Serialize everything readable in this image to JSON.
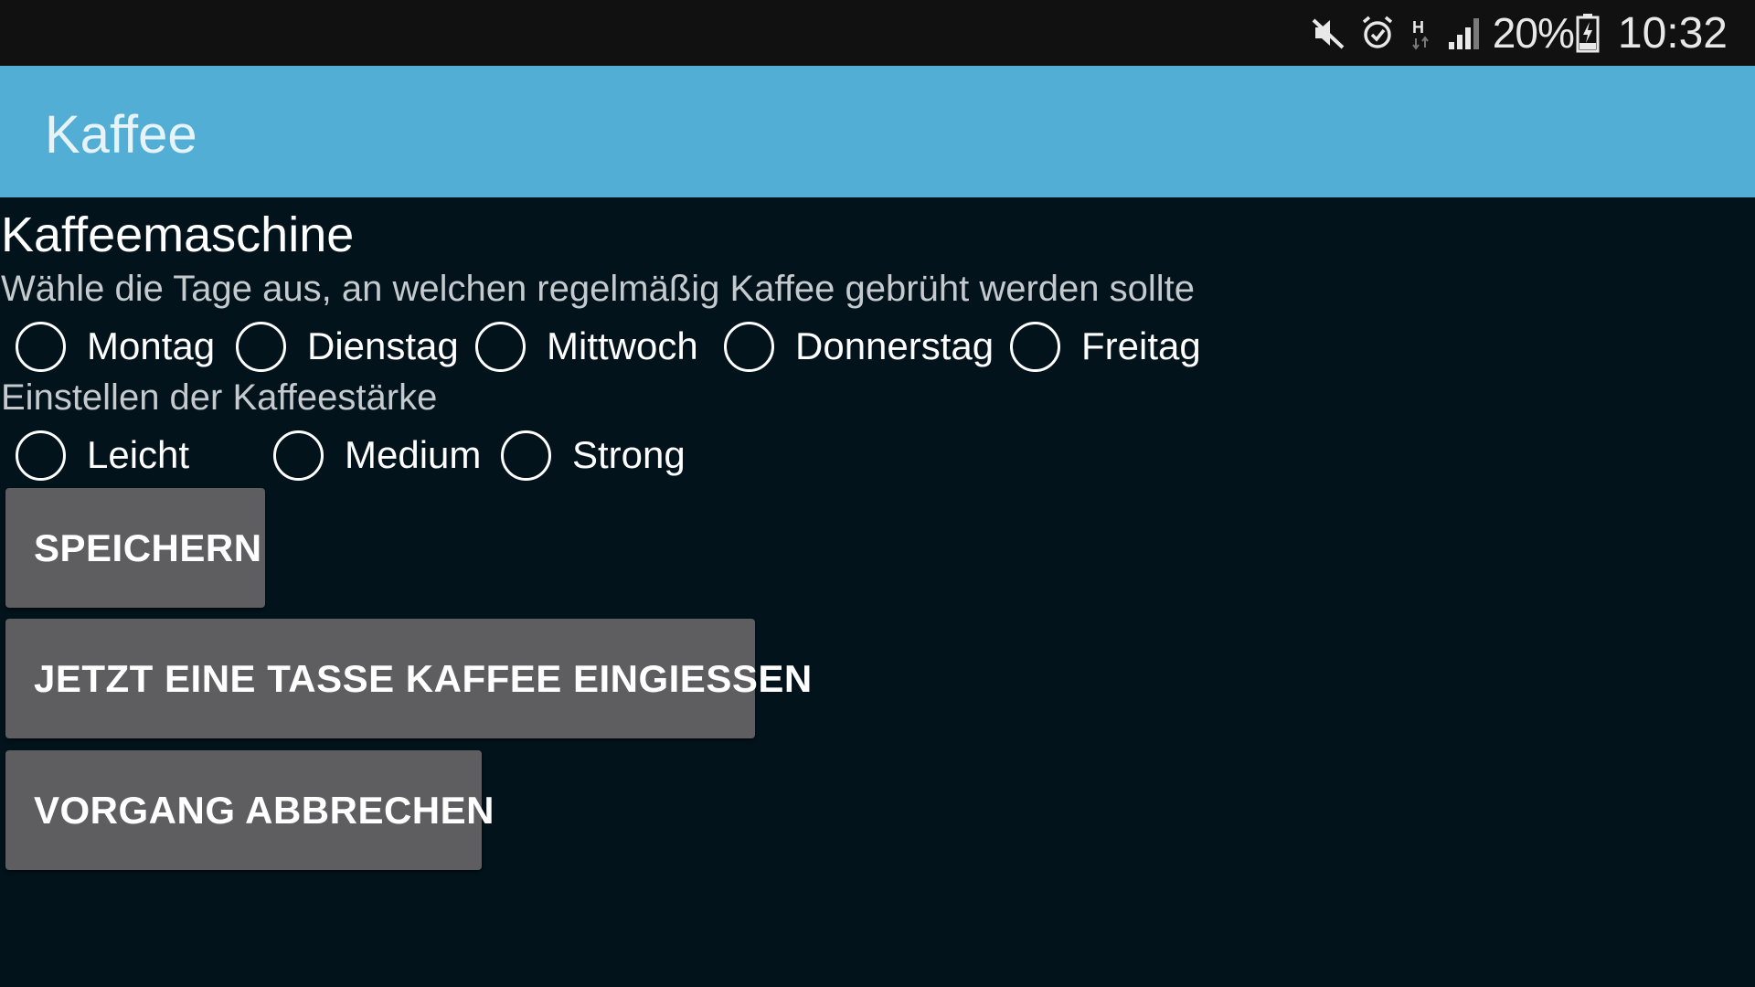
{
  "statusbar": {
    "icons": [
      "mute-icon",
      "alarm-icon",
      "network-h-icon",
      "signal-icon"
    ],
    "battery_text": "20%",
    "time": "10:32"
  },
  "appbar": {
    "title": "Kaffee"
  },
  "main": {
    "heading": "Kaffeemaschine",
    "days_prompt": "Wähle die Tage aus, an welchen regelmäßig Kaffee gebrüht werden sollte",
    "days": [
      {
        "label": "Montag",
        "checked": false
      },
      {
        "label": "Dienstag",
        "checked": false
      },
      {
        "label": "Mittwoch",
        "checked": false
      },
      {
        "label": "Donnerstag",
        "checked": false
      },
      {
        "label": "Freitag",
        "checked": false
      }
    ],
    "strength_prompt": "Einstellen der Kaffeestärke",
    "strengths": [
      {
        "label": "Leicht",
        "checked": false
      },
      {
        "label": "Medium",
        "checked": false
      },
      {
        "label": "Strong",
        "checked": false
      }
    ],
    "buttons": {
      "save": "SPEICHERN",
      "pour": "JETZT EINE TASSE KAFFEE EINGIESSEN",
      "cancel": "VORGANG ABBRECHEN"
    }
  },
  "colors": {
    "appbar": "#52aed4",
    "background": "#02131c",
    "statusbar": "#111111",
    "button": "#5e5d5f"
  }
}
